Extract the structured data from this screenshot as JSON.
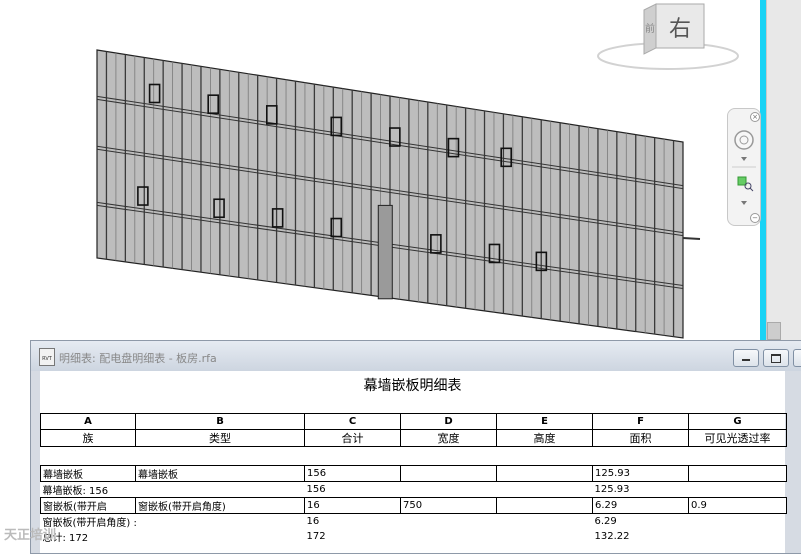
{
  "viewcube": {
    "face_label": "右",
    "side_label": "前"
  },
  "schedule_window": {
    "title": "明细表: 配电盘明细表 - 板房.rfa",
    "icon_label": "RVT",
    "table_title": "幕墙嵌板明细表",
    "column_letters": [
      "A",
      "B",
      "C",
      "D",
      "E",
      "F",
      "G"
    ],
    "column_headers": [
      "族",
      "类型",
      "合计",
      "宽度",
      "高度",
      "面积",
      "可见光透过率"
    ],
    "rows": [
      {
        "style": "boxed",
        "cells": [
          "幕墙嵌板",
          "幕墙嵌板",
          "156",
          "",
          "",
          "125.93",
          ""
        ]
      },
      {
        "style": "plain",
        "cells": [
          "幕墙嵌板: 156",
          "",
          "156",
          "",
          "",
          "125.93",
          ""
        ]
      },
      {
        "style": "boxed",
        "cells": [
          "窗嵌板(带开启",
          "窗嵌板(带开启角度)",
          "16",
          "750",
          "",
          "6.29",
          "0.9"
        ]
      },
      {
        "style": "plain",
        "cells": [
          "窗嵌板(带开启角度) : 16",
          "",
          "16",
          "",
          "",
          "6.29",
          ""
        ]
      },
      {
        "style": "plain",
        "cells": [
          "总计: 172",
          "",
          "172",
          "",
          "",
          "132.22",
          ""
        ]
      }
    ]
  },
  "watermark": "天正培训",
  "colors": {
    "accent_strip": "#19d3f5",
    "window_frame": "#d6dbe3"
  }
}
